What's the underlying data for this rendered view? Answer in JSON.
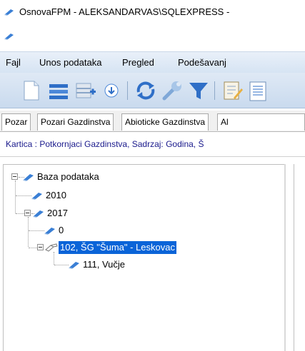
{
  "window": {
    "title": "OsnovaFPM - ALEKSANDARVAS\\SQLEXPRESS -",
    "app_icon": "book-pen-icon"
  },
  "menu": {
    "items": [
      "Fajl",
      "Unos podataka",
      "Pregled",
      "Podešavanj"
    ]
  },
  "toolbar": {
    "buttons": [
      "new-document-icon",
      "list-icon",
      "add-record-icon",
      "download-icon",
      "refresh-icon",
      "wrench-icon",
      "filter-icon",
      "edit-document-icon",
      "report-icon"
    ]
  },
  "tabs": {
    "items": [
      "Pozar",
      "Pozari Gazdinstva",
      "Abioticke Gazdinstva",
      "Al"
    ]
  },
  "info": {
    "text": "Kartica : Potkornjaci Gazdinstva, Sadrzaj: Godina, Š"
  },
  "tree": {
    "root": "Baza podataka",
    "n2010": "2010",
    "n2017": "2017",
    "n0": "0",
    "n102": "102, ŠG \"Šuma\" - Leskovac",
    "n111": "111, Vučje"
  },
  "colors": {
    "selection": "#0a64d8",
    "menubar": "#d6e4f3",
    "info_text": "#1a1a8c"
  }
}
